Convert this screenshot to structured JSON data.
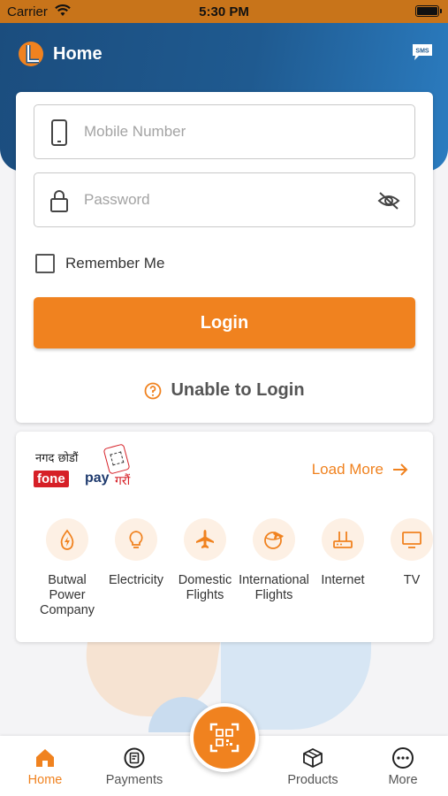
{
  "status_bar": {
    "carrier": "Carrier",
    "time": "5:30 PM"
  },
  "header": {
    "title": "Home",
    "sms_icon_text": "SMS"
  },
  "login": {
    "mobile_placeholder": "Mobile Number",
    "password_placeholder": "Password",
    "remember_label": "Remember Me",
    "remember_checked": false,
    "login_label": "Login",
    "unable_label": "Unable to Login"
  },
  "promo": {
    "line1": "नगद छोडौं",
    "fone": "fone",
    "pay": "pay",
    "line2": "गरौं"
  },
  "services": {
    "load_more_label": "Load More",
    "items": [
      {
        "label": "Butwal Power Company",
        "icon": "bolt-drop-icon"
      },
      {
        "label": "Electricity",
        "icon": "bulb-icon"
      },
      {
        "label": "Domestic Flights",
        "icon": "plane-icon"
      },
      {
        "label": "International Flights",
        "icon": "globe-plane-icon"
      },
      {
        "label": "Internet",
        "icon": "router-icon"
      },
      {
        "label": "TV",
        "icon": "tv-icon"
      }
    ]
  },
  "nav": {
    "items": [
      {
        "label": "Home",
        "icon": "home-icon",
        "active": true
      },
      {
        "label": "Payments",
        "icon": "payments-icon",
        "active": false
      },
      {
        "label": "Products",
        "icon": "box-icon",
        "active": false
      },
      {
        "label": "More",
        "icon": "more-icon",
        "active": false
      }
    ],
    "fab_icon": "qr-scan-icon"
  },
  "colors": {
    "accent": "#f0821f",
    "header": "#1f5a90",
    "status_bar": "#c8741a"
  }
}
